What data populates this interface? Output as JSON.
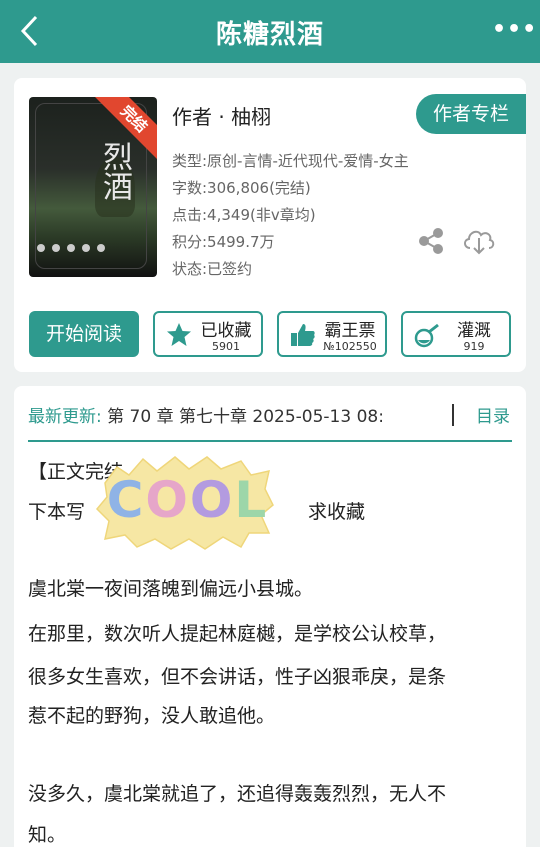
{
  "header": {
    "title": "陈糖烈酒",
    "more_label": "•••"
  },
  "book": {
    "cover_badge": "完结",
    "author_line": "作者 · 柚栩",
    "author_column_label": "作者专栏",
    "type": "类型:原创-言情-近代现代-爱情-女主",
    "word_count": "字数:306,806(完结)",
    "clicks": "点击:4,349(非v章均)",
    "score": "积分:5499.7万",
    "status": "状态:已签约"
  },
  "actions": {
    "read_label": "开始阅读",
    "favorite": {
      "label": "已收藏",
      "count": "5901"
    },
    "ticket": {
      "label": "霸王票",
      "count": "№102550"
    },
    "water": {
      "label": "灌溉",
      "count": "919"
    }
  },
  "latest": {
    "label": "最新更新:",
    "text": "第 70 章 第七十章 2025-05-13 08:",
    "toc_label": "目录"
  },
  "content": {
    "line1": "【正文完结",
    "line2_a": "下本写",
    "line2_b": "求收藏",
    "line3": "虞北棠一夜间落魄到偏远小县城。",
    "line4": "在那里，数次听人提起林庭樾，是学校公认校草，",
    "line5": "很多女生喜欢，但不会讲话，性子凶狠乖戾，是条",
    "line6": "惹不起的野狗，没人敢追他。",
    "line7": "没多久，虞北棠就追了，还追得轰轰烈烈，无人不",
    "line8": "知。"
  },
  "sticker": {
    "word": [
      "C",
      "O",
      "O",
      "L"
    ]
  },
  "colors": {
    "accent": "#2e9a8e",
    "badge": "#e1472f"
  }
}
